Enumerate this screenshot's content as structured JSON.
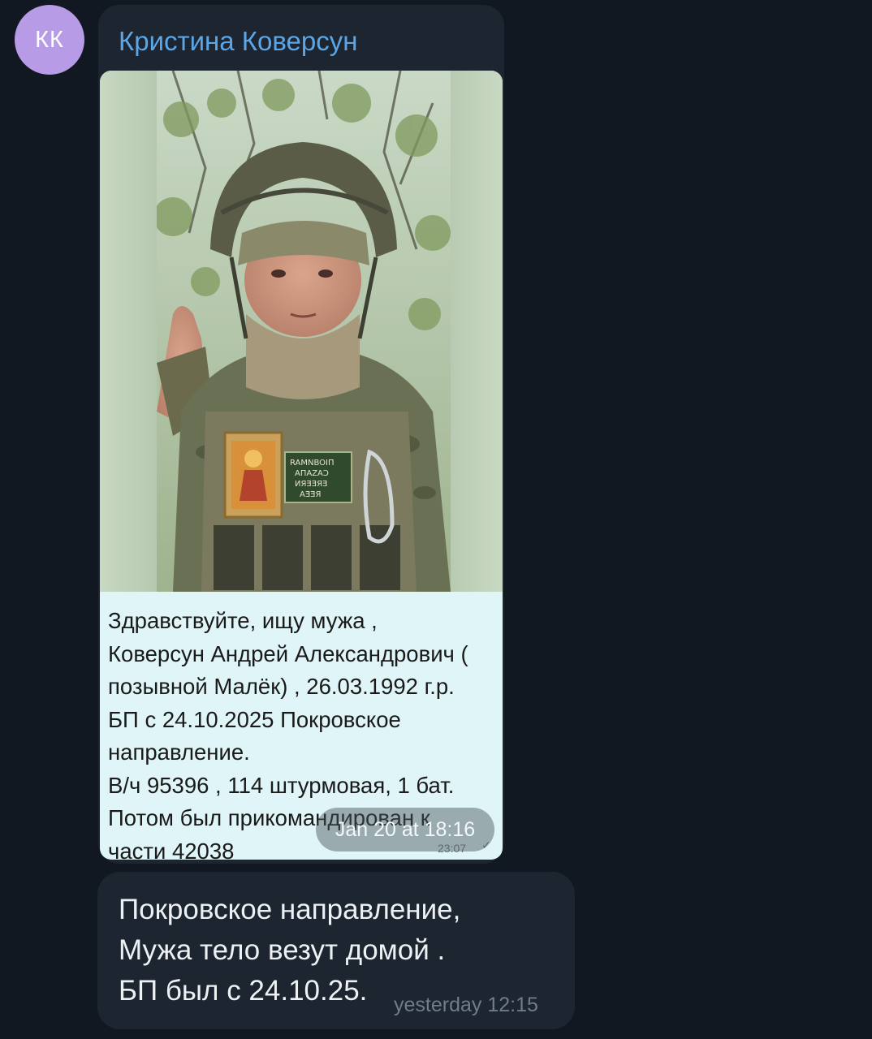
{
  "avatar": {
    "initials": "КК",
    "color": "#b79be6"
  },
  "message1": {
    "sender": "Кристина Коверсун",
    "photo": {
      "patch_text": [
        "RAMNBOIΠ",
        "ΑΠΑΖΑϽ",
        "ИЯƎƎЯƎ",
        "ΑƎƎЯ"
      ]
    },
    "caption_lines": [
      "Здравствуйте, ищу мужа ,",
      "Коверсун Андрей Александрович (",
      "позывной Малёк) , 26.03.1992 г.р.",
      "БП с 24.10.2025 Покровское",
      "направление.",
      "В/ч 95396 , 114 штурмовая, 1 бат.",
      "Потом был прикомандирован к",
      "части 42038"
    ],
    "time_overlay": "Jan 20 at 18:16",
    "inner_time": "23:07",
    "inner_check": "✓"
  },
  "message2": {
    "lines": [
      "Покровское направление,",
      "Мужа тело везут домой .",
      "БП был с 24.10.25."
    ],
    "time": "yesterday 12:15"
  },
  "colors": {
    "background": "#121821",
    "bubble": "#1d2530",
    "sender_name": "#5aa6e6",
    "caption_card": "#dff5f7"
  }
}
